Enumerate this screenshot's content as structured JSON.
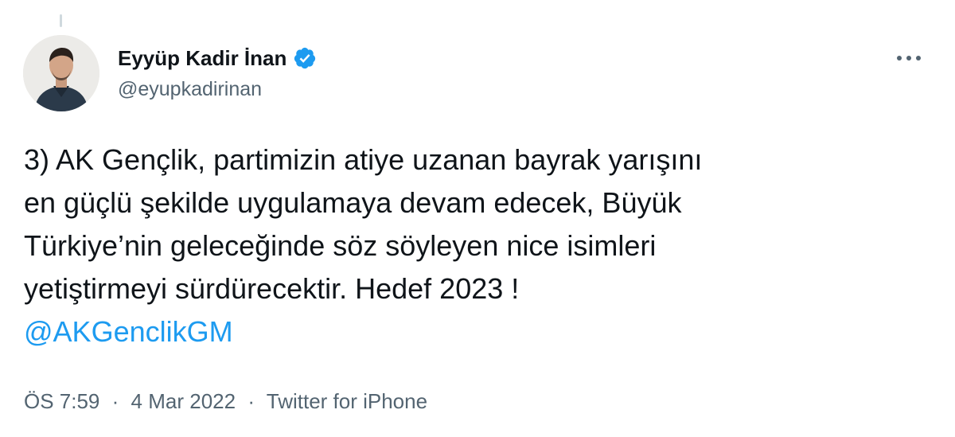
{
  "author": {
    "display_name": "Eyyüp Kadir İnan",
    "handle": "@eyupkadirinan",
    "verified_icon": "verified-badge-icon",
    "avatar_icon": "profile-photo"
  },
  "actions": {
    "more_icon": "more-horizontal-icon"
  },
  "tweet": {
    "lines": [
      "3) AK Gençlik, partimizin atiye uzanan bayrak yarışını",
      "en güçlü şekilde uygulamaya devam edecek, Büyük",
      "Türkiye’nin geleceğinde söz söyleyen nice isimleri",
      "yetiştirmeyi sürdürecektir. Hedef 2023 !"
    ],
    "mention": "@AKGenclikGM"
  },
  "meta": {
    "time": "ÖS 7:59",
    "separator": "·",
    "date": "4 Mar 2022",
    "source": "Twitter for iPhone"
  },
  "colors": {
    "accent": "#1d9bf0",
    "text": "#0f1419",
    "secondary": "#536471",
    "thread_line": "#cfd9de"
  }
}
